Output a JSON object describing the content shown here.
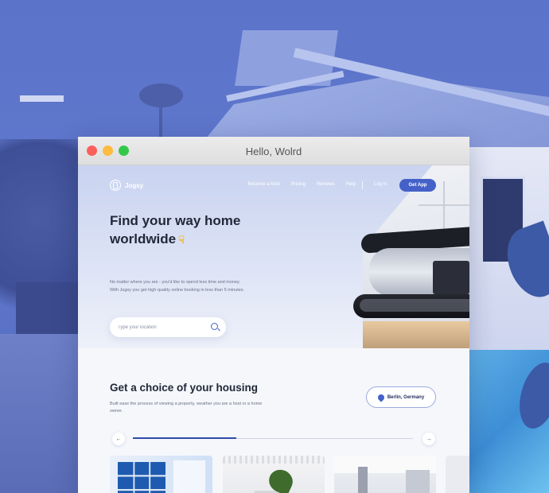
{
  "window": {
    "title": "Hello, Wolrd"
  },
  "brand": {
    "name": "Jogsy"
  },
  "nav": {
    "links": [
      "Become a host",
      "Pricing",
      "Reviews",
      "Help"
    ],
    "login_label": "Log In",
    "cta_label": "Get App"
  },
  "hero": {
    "title_line1": "Find your way home",
    "title_line2": "worldwide",
    "emoji_icon": "pointing-down-hand",
    "description": "No matter where you are - you'd like to spend less time and money. With Jogsy you get high quality online booking in less than 5 minutes.",
    "search": {
      "placeholder": "Type your location",
      "value": ""
    }
  },
  "housing": {
    "title": "Get a choice of your housing",
    "description": "Built ease the process of viewing a property, weather you are a host or a home owner.",
    "location_label": "Berlin, Germany",
    "slider_progress": 0.37,
    "prev_icon": "arrow-left-icon",
    "next_icon": "arrow-right-icon",
    "prev_glyph": "←",
    "next_glyph": "→"
  },
  "colors": {
    "accent": "#4461c9",
    "title_text": "#222838",
    "body_text": "#6a7186",
    "background_tint": "#5a70c4"
  }
}
